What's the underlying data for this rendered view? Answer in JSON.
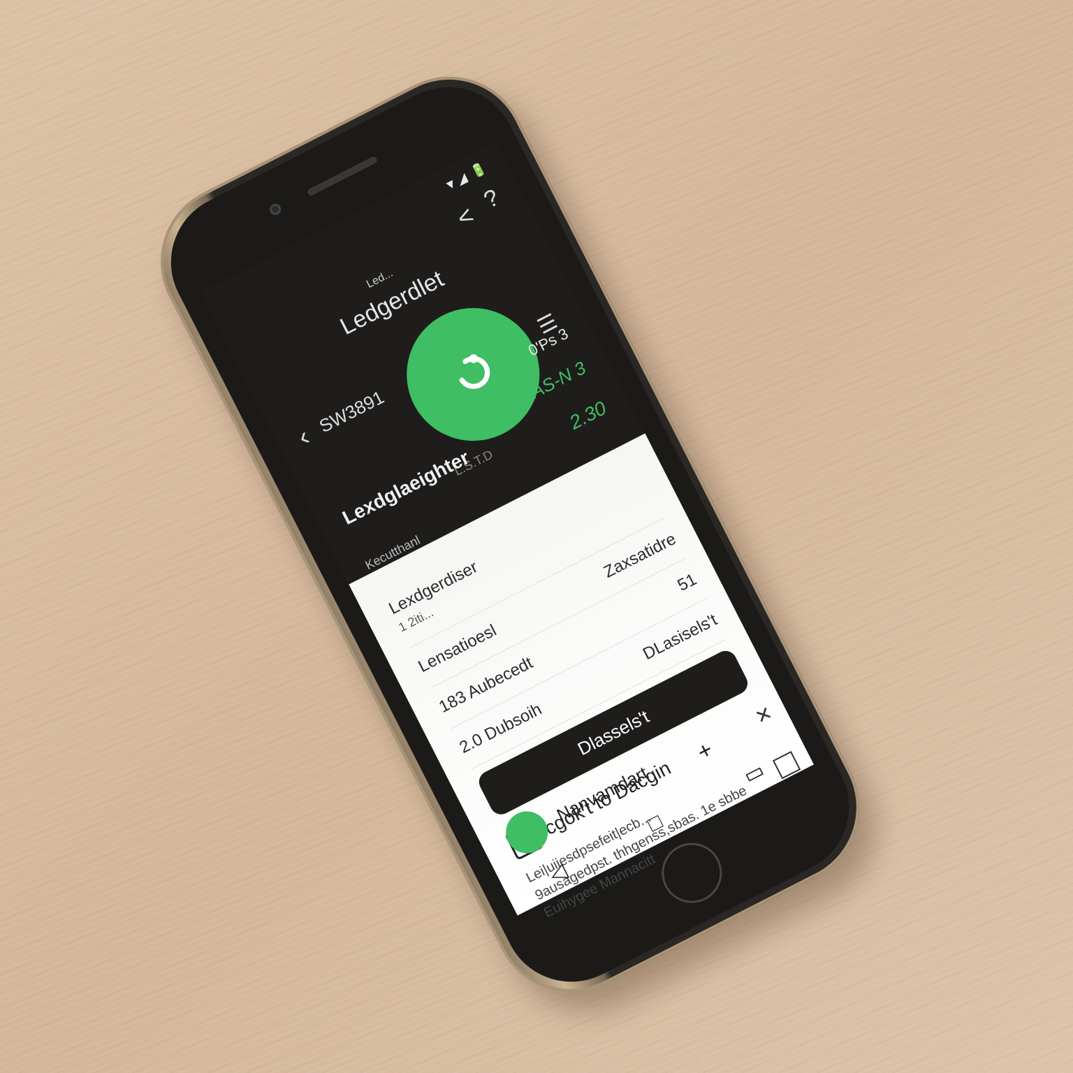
{
  "scene": {
    "surface": "wooden table",
    "device": "smartphone"
  },
  "status_bar": {
    "text": "▼◢ 🔋"
  },
  "top_nav": {
    "back": "<",
    "help": "?"
  },
  "header": {
    "small_label": "Led...",
    "title": "Ledgerdlet",
    "back_label": "SW3891",
    "dark_label": "L.S.T.D",
    "dark_footer": "Kecutthanl",
    "section_title": "Lexdglaeighter"
  },
  "summary_right": {
    "stat": "0'Ps 3",
    "green_1": "AS-N 3",
    "green_2": "2.30",
    "menu_icon_label": "☰"
  },
  "rows": [
    {
      "label": "Lexdgerdiser",
      "sub": "1 2iti..."
    },
    {
      "label": "Lensatioesl",
      "value": "Zaxsatidre"
    },
    {
      "label": "183 Aubecedt",
      "value": "51"
    },
    {
      "label": "2.0 Dubsoih",
      "value": "DLasisels't"
    }
  ],
  "primary_button": {
    "label": "Dlassels't"
  },
  "details": {
    "title": "cgok't to Dacgin",
    "lines": [
      "Lei|uiiesdpsefeit|ecb...",
      "9ausagedpst. thhgenss,sbas. 1e sbbe",
      "Euihygee Mannacitt"
    ]
  },
  "bottom": {
    "name": "Nanvamdart",
    "plus": "+"
  },
  "nav": {
    "back": "◁",
    "home": "□",
    "recent": "▭"
  },
  "colors": {
    "accent": "#3fbe63",
    "dark": "#1e1d1b"
  }
}
